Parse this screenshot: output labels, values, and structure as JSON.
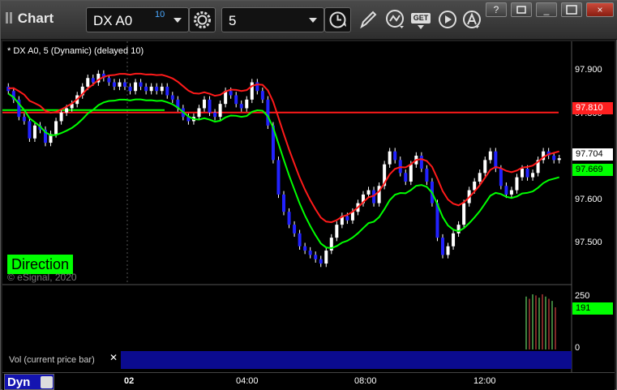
{
  "toolbar": {
    "app_title": "Chart",
    "symbol": "DX A0",
    "symbol_delay": "10",
    "interval": "5",
    "get_label": "GET",
    "window_buttons": {
      "help": "?",
      "minimize": "_",
      "close": "×"
    }
  },
  "chart": {
    "study_label": "* DX A0, 5 (Dynamic) (delayed 10)",
    "direction_label": "Direction",
    "watermark": "© eSignal, 2020",
    "price_ticks": [
      "97.900",
      "97.800",
      "97.600",
      "97.500"
    ],
    "last_price": "97.704",
    "red_level": "97.810",
    "green_level": "97.669",
    "colors": {
      "up_candle": "#ffffff",
      "down_candle": "#2222ff",
      "red_line": "#ff1a1a",
      "green_line": "#00ff00",
      "background": "#000000"
    }
  },
  "volume_panel": {
    "label": "Vol (current price bar)",
    "close_glyph": "✕",
    "ticks": [
      "250",
      "0"
    ],
    "current_value": "191"
  },
  "time_axis": {
    "labels": [
      "02",
      "04:00",
      "08:00",
      "12:00"
    ],
    "mode_button": "Dyn"
  },
  "chart_data": {
    "type": "candlestick",
    "x_labels": [
      "02",
      "04:00",
      "08:00",
      "12:00"
    ],
    "y_ticks": [
      97.9,
      97.8,
      97.6,
      97.5
    ],
    "ylim": [
      97.43,
      97.96
    ],
    "horizontal_levels": [
      {
        "name": "red",
        "value": 97.81
      },
      {
        "name": "green",
        "value": 97.669
      }
    ],
    "last_price": 97.704,
    "closes": [
      97.86,
      97.84,
      97.8,
      97.79,
      97.75,
      97.78,
      97.77,
      97.74,
      97.76,
      97.79,
      97.81,
      97.82,
      97.83,
      97.85,
      97.87,
      97.89,
      97.88,
      97.9,
      97.89,
      97.88,
      97.87,
      97.88,
      97.87,
      97.86,
      97.88,
      97.87,
      97.86,
      97.87,
      97.86,
      97.87,
      97.85,
      97.84,
      97.82,
      97.8,
      97.79,
      97.8,
      97.82,
      97.84,
      97.81,
      97.8,
      97.83,
      97.86,
      97.85,
      97.83,
      97.82,
      97.84,
      97.88,
      97.86,
      97.84,
      97.78,
      97.7,
      97.62,
      97.58,
      97.55,
      97.53,
      97.5,
      97.49,
      97.48,
      97.47,
      97.46,
      97.49,
      97.52,
      97.55,
      97.57,
      97.56,
      97.58,
      97.6,
      97.62,
      97.63,
      97.6,
      97.64,
      97.69,
      97.72,
      97.7,
      97.67,
      97.65,
      97.69,
      97.71,
      97.68,
      97.65,
      97.6,
      97.52,
      97.48,
      97.5,
      97.53,
      97.55,
      97.6,
      97.63,
      97.65,
      97.67,
      97.7,
      97.72,
      97.68,
      97.64,
      97.62,
      97.63,
      97.66,
      97.68,
      97.66,
      97.67,
      97.7,
      97.72,
      97.71,
      97.7,
      97.704
    ]
  }
}
